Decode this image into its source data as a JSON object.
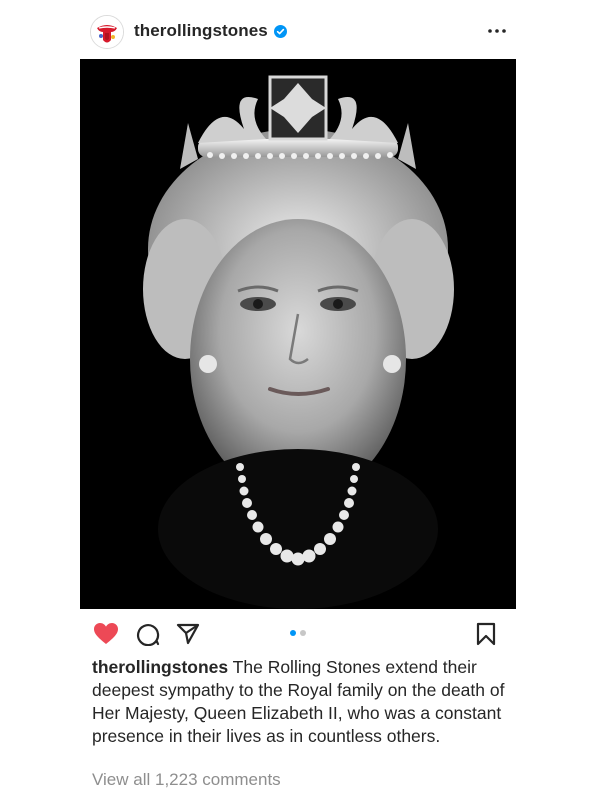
{
  "post": {
    "username": "therollingstones",
    "verified_icon": "verified-badge-icon",
    "more_icon": "more-horizontal-icon",
    "image_alt": "Black and white portrait of Queen Elizabeth II wearing a diamond diadem and pearl necklace",
    "carousel": {
      "count": 2,
      "active_index": 0
    },
    "actions": {
      "liked": true,
      "like_icon": "heart-icon",
      "comment_icon": "comment-icon",
      "share_icon": "paper-plane-icon",
      "save_icon": "bookmark-icon"
    },
    "caption": {
      "username": "therollingstones",
      "text": "The Rolling Stones extend their deepest sympathy to the Royal family on the death of Her Majesty, Queen Elizabeth II, who was a constant presence in their lives as in countless others."
    },
    "comments_link": "View all 1,223 comments"
  },
  "colors": {
    "like": "#ed4956",
    "verified": "#0095f6",
    "muted": "#8e8e8e",
    "text": "#262626"
  }
}
